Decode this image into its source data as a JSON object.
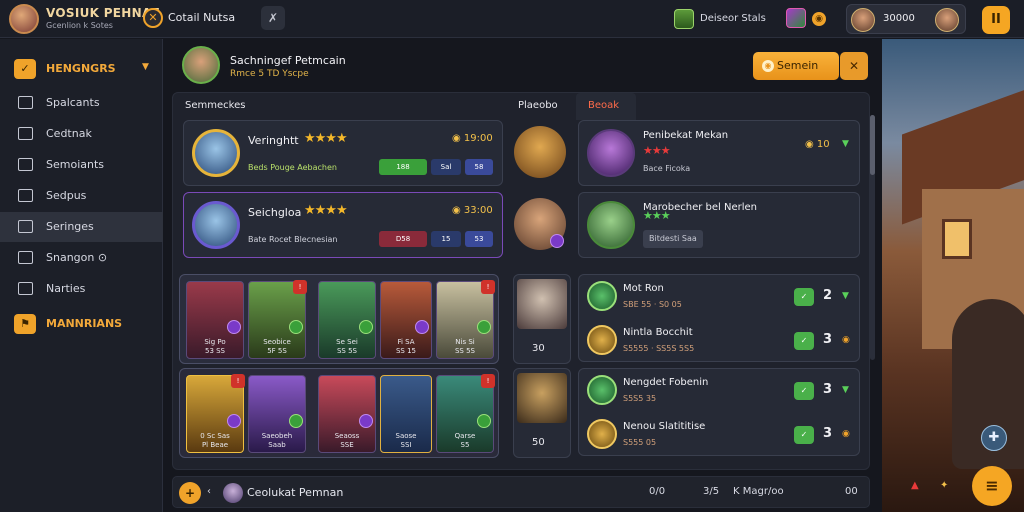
{
  "topbar": {
    "game_title": "VOSIUK PEHNAE",
    "game_subtitle": "Gcenlion k Sotes",
    "tab_label": "Cotail Nutsa",
    "tool_icon": "wrench-icon",
    "resource_label": "Deiseor Stals",
    "player_score": "30000",
    "pause_label": "II"
  },
  "sidebar": {
    "head1": {
      "icon": "check-icon",
      "label": "HENGNGRS"
    },
    "items": [
      {
        "label": "Spalcants",
        "icon": "list-icon"
      },
      {
        "label": "Cedtnak",
        "icon": "grid-icon"
      },
      {
        "label": "Semoiants",
        "icon": "document-icon"
      },
      {
        "label": "Sedpus",
        "icon": "arrow-icon"
      },
      {
        "label": "Seringes",
        "icon": "arrow-icon",
        "active": true
      },
      {
        "label": "Snangon ⊙",
        "icon": "table-icon"
      },
      {
        "label": "Narties",
        "icon": "edit-icon"
      }
    ],
    "head2": {
      "icon": "flag-icon",
      "label": "MANNRIANS"
    }
  },
  "header": {
    "title": "Sachningef Petmcain",
    "subtitle": "Rmce 5 TD Yscpe",
    "claim_label": "Semein",
    "close_label": "✕"
  },
  "board": {
    "col1": "Semmeckes",
    "col2": "Plaeobo",
    "col3": "Beoak"
  },
  "left_cards": [
    {
      "name": "Veringhtt",
      "stars": "★★★★",
      "coins": "19:00",
      "sub": "Beds Pouge Aebachen",
      "pills": [
        "188",
        "Sal",
        "58"
      ]
    },
    {
      "name": "Seichgloa",
      "stars": "★★★★",
      "coins": "33:00",
      "sub": "Bate Rocet Blecnesian",
      "pills": [
        "D58",
        "15",
        "53"
      ]
    }
  ],
  "right_cards": [
    {
      "name": "Penibekat Mekan",
      "stars": "★★★",
      "value": "10",
      "sub": "Bace Ficoka"
    },
    {
      "name": "Marobecher bel Nerlen",
      "stars": "★★★",
      "sub": "Bitdesti Saa"
    }
  ],
  "deck1": [
    {
      "name": "Sig Po",
      "val": "53 SS"
    },
    {
      "name": "Seobice",
      "val": "5F 5S"
    },
    {
      "name": "Se Sei",
      "val": "SS 5S"
    },
    {
      "name": "Fi SA",
      "val": "SS 15"
    },
    {
      "name": "Nis Si",
      "val": "SS 5S"
    }
  ],
  "deck2": [
    {
      "name": "0 Sc Sas",
      "val": "Pl Beae"
    },
    {
      "name": "Saeobeh",
      "val": "Saab"
    },
    {
      "name": "Seaoss",
      "val": "SSE"
    },
    {
      "name": "Saose",
      "val": "SSI"
    },
    {
      "name": "Qarse",
      "val": "S5"
    }
  ],
  "small_col": {
    "v1": "30",
    "v2": "50"
  },
  "mission_rows": [
    {
      "title": "Mot Ron",
      "sub": "SBE 55 · S0 05",
      "count": "2"
    },
    {
      "title": "Nintla Bocchit",
      "sub": "S5555 · SS5S 5S5",
      "count": "3"
    },
    {
      "title": "Nengdet Fobenin",
      "sub": "S5S5 35",
      "count": "3"
    },
    {
      "title": "Nenou Slatititise",
      "sub": "S555 05",
      "count": "3"
    }
  ],
  "bottom": {
    "label": "Ceolukat Pemnan",
    "s1": "0/0",
    "s2": "3/5",
    "s3": "K Magr/oo",
    "s4": "",
    "s5": "00"
  },
  "colors": {
    "accent": "#f5a623",
    "panel": "#262a36",
    "sidebar": "#1c1f28"
  }
}
